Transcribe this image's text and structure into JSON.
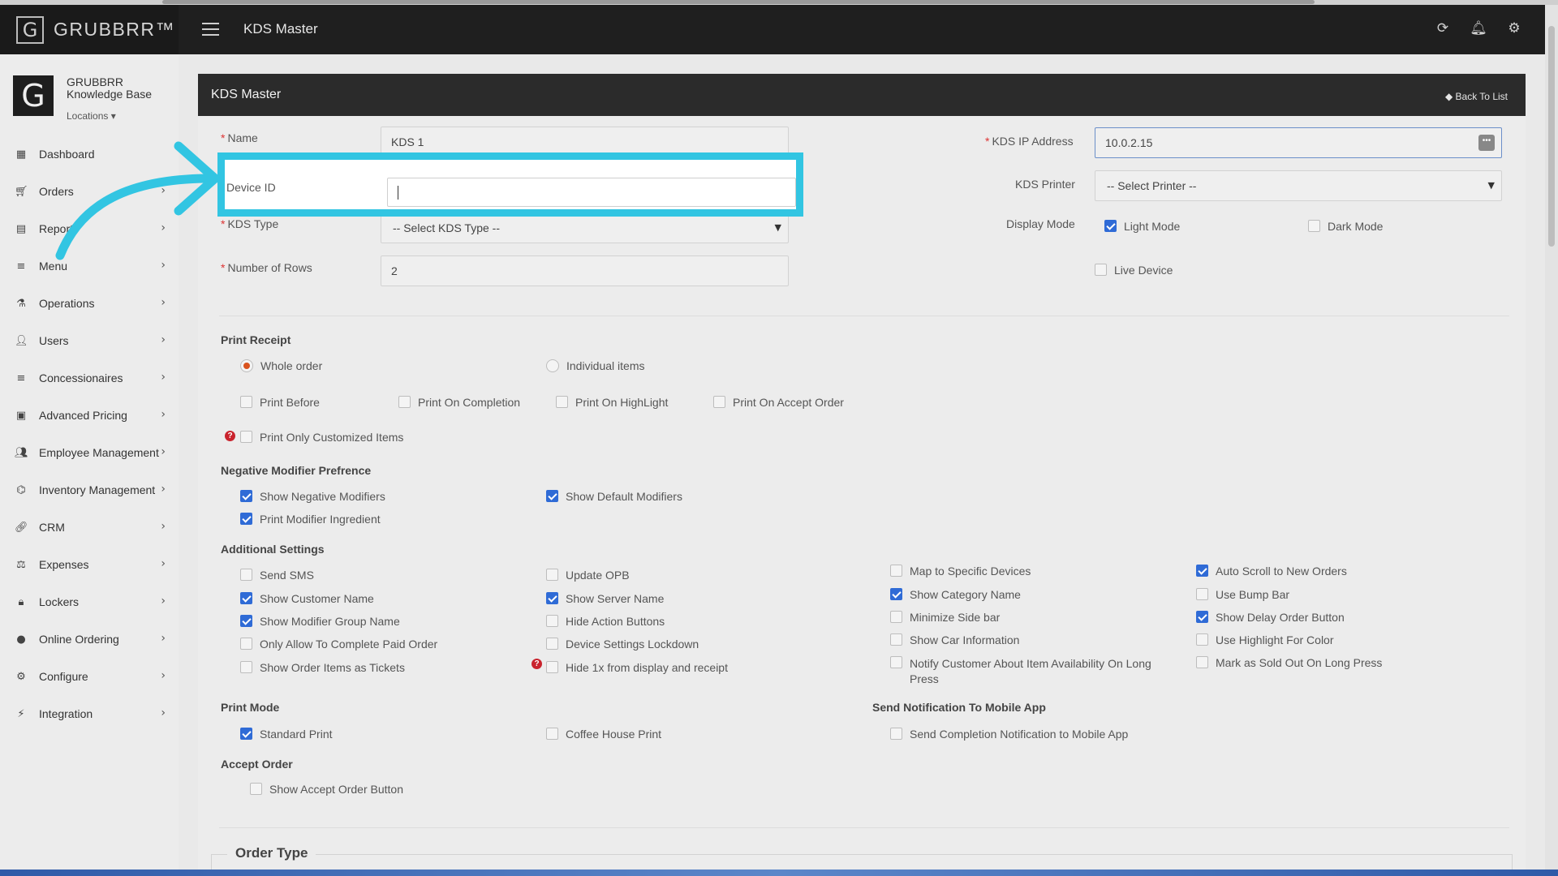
{
  "app": {
    "brand": "GRUBBRR™",
    "logo_letter": "G",
    "page_title": "KDS Master"
  },
  "profile": {
    "name": "GRUBBRR Knowledge Base",
    "locations_label": "Locations ▾"
  },
  "sidebar": {
    "items": [
      {
        "label": "Dashboard",
        "icon": "dashboard-icon"
      },
      {
        "label": "Orders",
        "icon": "cart-icon"
      },
      {
        "label": "Reports",
        "icon": "report-icon"
      },
      {
        "label": "Menu",
        "icon": "menu-icon"
      },
      {
        "label": "Operations",
        "icon": "flask-icon"
      },
      {
        "label": "Users",
        "icon": "user-plus-icon"
      },
      {
        "label": "Concessionaires",
        "icon": "list-icon"
      },
      {
        "label": "Advanced Pricing",
        "icon": "money-icon"
      },
      {
        "label": "Employee Management",
        "icon": "users-icon"
      },
      {
        "label": "Inventory Management",
        "icon": "sitemap-icon"
      },
      {
        "label": "CRM",
        "icon": "link-icon"
      },
      {
        "label": "Expenses",
        "icon": "balance-icon"
      },
      {
        "label": "Lockers",
        "icon": "lock-icon"
      },
      {
        "label": "Online Ordering",
        "icon": "globe-icon"
      },
      {
        "label": "Configure",
        "icon": "cog-icon"
      },
      {
        "label": "Integration",
        "icon": "plug-icon"
      }
    ]
  },
  "panel": {
    "title": "KDS Master",
    "back_label": "Back To List"
  },
  "form": {
    "name_label": "Name",
    "name_value": "KDS 1",
    "device_id_label": "Device ID",
    "device_id_value": "",
    "kds_type_label": "KDS Type",
    "kds_type_value": "-- Select KDS Type --",
    "rows_label": "Number of Rows",
    "rows_value": "2",
    "ip_label": "KDS IP Address",
    "ip_value": "10.0.2.15",
    "printer_label": "KDS Printer",
    "printer_value": "-- Select Printer --",
    "display_mode_label": "Display Mode",
    "light_mode": "Light Mode",
    "dark_mode": "Dark Mode",
    "live_device": "Live Device"
  },
  "print_receipt": {
    "title": "Print Receipt",
    "whole_order": "Whole order",
    "individual_items": "Individual items",
    "print_before": "Print Before",
    "print_on_completion": "Print On Completion",
    "print_on_highlight": "Print On HighLight",
    "print_on_accept": "Print On Accept Order",
    "print_only_customized": "Print Only Customized Items"
  },
  "negative_modifier": {
    "title": "Negative Modifier Prefrence",
    "show_negative": "Show Negative Modifiers",
    "show_default": "Show Default Modifiers",
    "print_ingredient": "Print Modifier Ingredient"
  },
  "additional": {
    "title": "Additional Settings",
    "send_sms": "Send SMS",
    "update_opb": "Update OPB",
    "show_customer_name": "Show Customer Name",
    "show_server_name": "Show Server Name",
    "show_modifier_group": "Show Modifier Group Name",
    "hide_action_buttons": "Hide Action Buttons",
    "only_allow_paid": "Only Allow To Complete Paid Order",
    "device_lockdown": "Device Settings Lockdown",
    "show_items_tickets": "Show Order Items as Tickets",
    "hide_1x": "Hide 1x from display and receipt",
    "map_devices": "Map to Specific Devices",
    "show_category_name": "Show Category Name",
    "minimize_side_bar": "Minimize Side bar",
    "show_car_info": "Show Car Information",
    "notify_customer_line1": "Notify Customer About Item Availability On Long",
    "notify_customer_line2": "Press",
    "auto_scroll": "Auto Scroll to New Orders",
    "use_bump_bar": "Use Bump Bar",
    "show_delay_button": "Show Delay Order Button",
    "use_highlight_color": "Use Highlight For Color",
    "mark_sold_out": "Mark as Sold Out On Long Press"
  },
  "print_mode": {
    "title": "Print Mode",
    "standard": "Standard Print",
    "coffee_house": "Coffee House Print"
  },
  "notification": {
    "title": "Send Notification To Mobile App",
    "send_completion": "Send Completion Notification to Mobile App"
  },
  "accept_order": {
    "title": "Accept Order",
    "show_button": "Show Accept Order Button"
  },
  "order_type": {
    "title": "Order Type"
  },
  "colors": {
    "accent_highlight": "#32c5e2",
    "checkbox_on": "#2f6bd6",
    "radio_on": "#d9531e",
    "topbar": "#1f1f1f"
  }
}
